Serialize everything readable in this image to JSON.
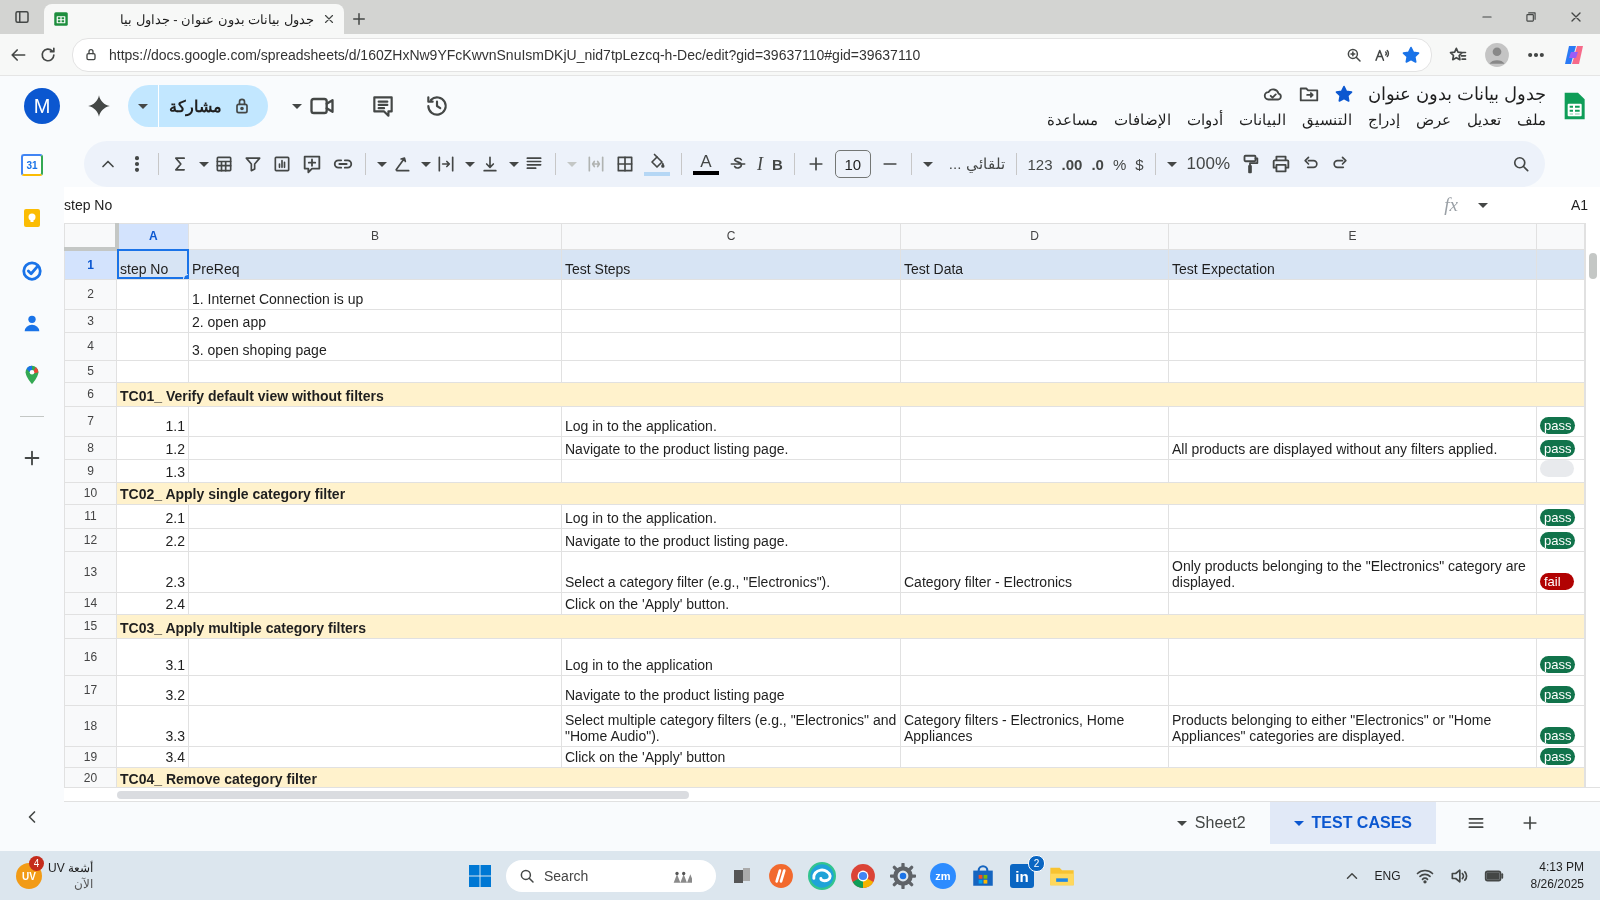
{
  "browser": {
    "tab_title": "جدول بيانات بدون عنوان - جداول بيا",
    "url": "https://docs.google.com/spreadsheets/d/160ZHxNw9YFcKwvnSnuIsmDKjU_nid7tpLezcq-h-Dec/edit?gid=39637110#gid=39637110",
    "bookmarked": true
  },
  "document": {
    "title": "جدول بيانات بدون عنوان",
    "starred": true,
    "avatar": "M",
    "share_label": "مشاركة",
    "menu": [
      "ملف",
      "تعديل",
      "عرض",
      "إدراج",
      "التنسيق",
      "البيانات",
      "أدوات",
      "الإضافات",
      "مساعدة"
    ]
  },
  "side_panel": {
    "calendar_day": "31"
  },
  "toolbar": {
    "zoom": "100%",
    "currency": "$",
    "percent": "%",
    "decrease_decimals": ".0",
    "increase_decimals": ".00",
    "number_format": "123",
    "font": "تلقائي ...",
    "font_size": "10",
    "bold": "B",
    "italic": "I",
    "text_color": "A"
  },
  "formula_bar": {
    "cell": "A1",
    "function_label": "fx",
    "content": "step No"
  },
  "grid": {
    "columns": [
      {
        "label": "A",
        "selected": true
      },
      {
        "label": "B",
        "selected": false
      },
      {
        "label": "C",
        "selected": false
      },
      {
        "label": "D",
        "selected": false
      },
      {
        "label": "E",
        "selected": false
      }
    ],
    "rows": [
      {
        "number": "1",
        "kind": "header",
        "selected": true,
        "cells": {
          "A": "step No",
          "B": "PreReq",
          "C": "Test Steps",
          "D": "Test Data",
          "E": "Test Expectation"
        }
      },
      {
        "number": "2",
        "kind": "row",
        "selected": false,
        "cells": {
          "B": "1. Internet Connection is up"
        }
      },
      {
        "number": "3",
        "kind": "row",
        "selected": false,
        "cells": {
          "B": "2. open app"
        }
      },
      {
        "number": "4",
        "kind": "row",
        "selected": false,
        "cells": {
          "B": "3. open shoping page"
        }
      },
      {
        "number": "5",
        "kind": "row",
        "selected": false,
        "cells": {}
      },
      {
        "number": "6",
        "kind": "section",
        "selected": false,
        "title": "TC01_ Verify default view without filters"
      },
      {
        "number": "7",
        "kind": "row",
        "selected": false,
        "cells": {
          "A": "1.1",
          "C": "Log in to the application."
        },
        "status": {
          "label": "pass",
          "color": "#11734b"
        }
      },
      {
        "number": "8",
        "kind": "row",
        "selected": false,
        "cells": {
          "A": "1.2",
          "C": "Navigate to the product listing page.",
          "E": "All products are displayed without any filters applied."
        },
        "status": {
          "label": "pass",
          "color": "#11734b"
        }
      },
      {
        "number": "9",
        "kind": "row",
        "selected": false,
        "cells": {
          "A": "1.3"
        },
        "status": {
          "color": "#e8eaed"
        }
      },
      {
        "number": "10",
        "kind": "section",
        "selected": false,
        "title": "TC02_ Apply single category filter"
      },
      {
        "number": "11",
        "kind": "row",
        "selected": false,
        "cells": {
          "A": "2.1",
          "C": "Log in to the application."
        },
        "status": {
          "label": "pass",
          "color": "#11734b"
        }
      },
      {
        "number": "12",
        "kind": "row",
        "selected": false,
        "cells": {
          "A": "2.2",
          "C": "Navigate to the product listing page."
        },
        "status": {
          "label": "pass",
          "color": "#11734b"
        }
      },
      {
        "number": "13",
        "kind": "row",
        "selected": false,
        "cells": {
          "A": "2.3",
          "C": "Select a category filter (e.g., \"Electronics\").",
          "D": "Category filter - Electronics",
          "E": "Only products belonging to the \"Electronics\" category are displayed."
        },
        "status": {
          "label": "fail",
          "color": "#b10202"
        }
      },
      {
        "number": "14",
        "kind": "row",
        "selected": false,
        "cells": {
          "A": "2.4",
          "C": "Click on the 'Apply' button."
        }
      },
      {
        "number": "15",
        "kind": "section",
        "selected": false,
        "title": "TC03_ Apply multiple category filters"
      },
      {
        "number": "16",
        "kind": "row",
        "selected": false,
        "cells": {
          "A": "3.1",
          "C": "Log in to the application"
        },
        "status": {
          "label": "pass",
          "color": "#11734b"
        }
      },
      {
        "number": "17",
        "kind": "row",
        "selected": false,
        "cells": {
          "A": "3.2",
          "C": "Navigate to the product listing page"
        },
        "status": {
          "label": "pass",
          "color": "#11734b"
        }
      },
      {
        "number": "18",
        "kind": "row",
        "selected": false,
        "cells": {
          "A": "3.3",
          "C": "Select multiple category filters (e.g., \"Electronics\" and \"Home Audio\").",
          "D": "Category filters - Electronics, Home Appliances",
          "E": "Products belonging to either \"Electronics\" or \"Home Appliances\" categories are displayed."
        },
        "status": {
          "label": "pass",
          "color": "#11734b"
        }
      },
      {
        "number": "19",
        "kind": "row",
        "selected": false,
        "cells": {
          "A": "3.4",
          "C": "Click on the 'Apply' button"
        },
        "status": {
          "label": "pass",
          "color": "#11734b"
        }
      },
      {
        "number": "20",
        "kind": "section",
        "selected": false,
        "title": "TC04_ Remove category filter"
      }
    ]
  },
  "sheet_tabs": [
    {
      "label": "Sheet2",
      "selected": false
    },
    {
      "label": "TEST CASES",
      "selected": true
    }
  ],
  "taskbar": {
    "widget": {
      "badge": "4",
      "icon_text": "UV",
      "title": "أشعة UV",
      "subtitle": "الآن"
    },
    "search_placeholder": "Search",
    "zoom_icon": "zm",
    "linkedin_icon": "in",
    "linkedin_badge": "2",
    "language": "ENG",
    "time": "4:13 PM",
    "date": "8/26/2025"
  }
}
